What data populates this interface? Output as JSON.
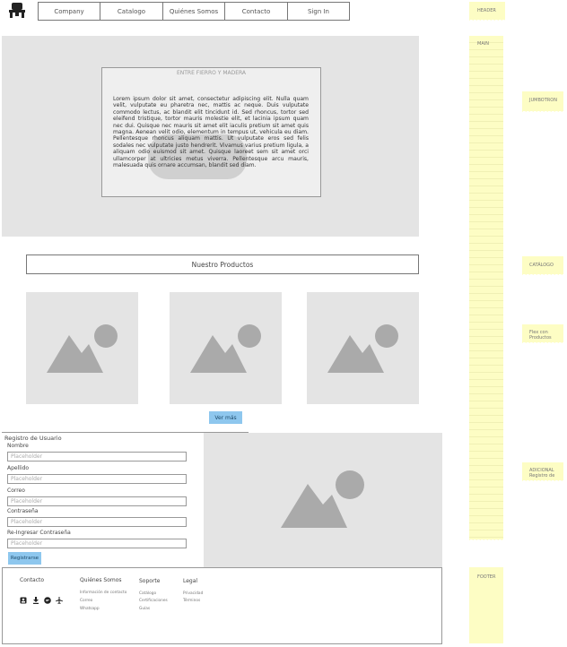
{
  "header": {
    "nav": [
      "Company",
      "Catalogo",
      "Quiénes Somos",
      "Contacto",
      "Sign In"
    ]
  },
  "jumbotron": {
    "title": "ENTRE FIERRO Y MADERA",
    "body": "Lorem ipsum dolor sit amet, consectetur adipiscing elit. Nulla quam velit, vulputate eu pharetra nec, mattis ac neque. Duis vulputate commodo lectus, ac blandit elit tincidunt id. Sed rhoncus, tortor sed eleifend tristique, tortor mauris molestie elit, et lacinia ipsum quam nec dui. Quisque nec mauris sit amet elit iaculis pretium sit amet quis magna. Aenean velit odio, elementum in tempus ut, vehicula eu diam. Pellentesque rhoncus aliquam mattis. Ut vulputate eros sed felis sodales nec vulputate justo hendrerit. Vivamus varius pretium ligula, a aliquam odio euismod sit amet. Quisque laoreet sem sit amet orci ullamcorper at ultricies metus viverra. Pellentesque arcu mauris, malesuada quis ornare accumsan, blandit sed diam."
  },
  "catalog": {
    "title": "Nuestro Productos",
    "button": "Ver más"
  },
  "register": {
    "title": "Registro de Usuario",
    "fields": [
      {
        "label": "Nombre",
        "placeholder": "Placeholder"
      },
      {
        "label": "Apellido",
        "placeholder": "Placeholder"
      },
      {
        "label": "Correo",
        "placeholder": "Placeholder"
      },
      {
        "label": "Contraseña",
        "placeholder": "Placeholder"
      },
      {
        "label": "Re-Ingresar Contraseña",
        "placeholder": "Placeholder"
      }
    ],
    "button": "Registrarse"
  },
  "footer": {
    "contacto": {
      "title": "Contacto"
    },
    "quienes": {
      "title": "Quiénes Somos",
      "links": [
        "Información de contacto",
        "Correo",
        "Whatsapp"
      ]
    },
    "soporte": {
      "title": "Soporte",
      "links": [
        "Catálogo",
        "Certificaciones",
        "Guías"
      ]
    },
    "legal": {
      "title": "Legal",
      "links": [
        "Privacidad",
        "Términos"
      ]
    }
  },
  "notes": {
    "header": "HEADER",
    "main": "MAIN",
    "jumbotron": "JUMBOTRON",
    "catalogo": "CATÁLOGO",
    "flex": "Flex con Productos",
    "adicional": "ADICIONAL Registro de",
    "footer": "FOOTER"
  },
  "colors": {
    "accent_button": "#8ec7ee",
    "placeholder_gray": "#e4e4e4",
    "sticky_note": "#fdfdc4"
  }
}
